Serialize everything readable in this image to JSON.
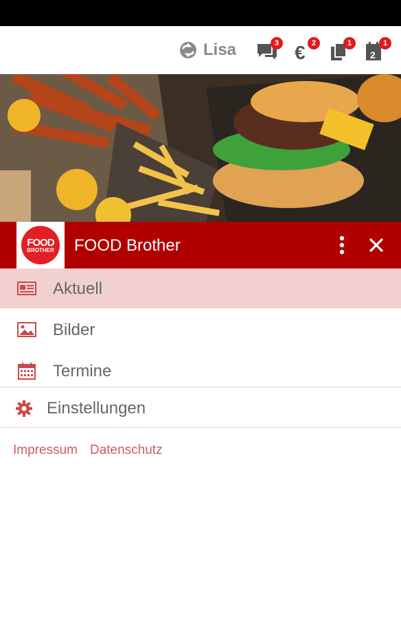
{
  "topbar": {
    "user_name": "Lisa",
    "badges": {
      "chat": "3",
      "payment": "2",
      "documents": "1",
      "calendar": "1"
    }
  },
  "drawer": {
    "title": "FOOD Brother",
    "logo_line1": "FOOD",
    "logo_line2": "BROTHER",
    "items": [
      {
        "label": "Aktuell",
        "icon": "newspaper-icon",
        "active": true
      },
      {
        "label": "Bilder",
        "icon": "image-icon",
        "active": false
      },
      {
        "label": "Termine",
        "icon": "calendar-icon",
        "active": false
      }
    ],
    "settings_label": "Einstellungen"
  },
  "footer": {
    "impressum": "Impressum",
    "datenschutz": "Datenschutz"
  },
  "colors": {
    "brand_red": "#b10000",
    "icon_red": "#c94a4a",
    "active_bg": "#f2d0d0",
    "badge_red": "#e01b1b"
  }
}
